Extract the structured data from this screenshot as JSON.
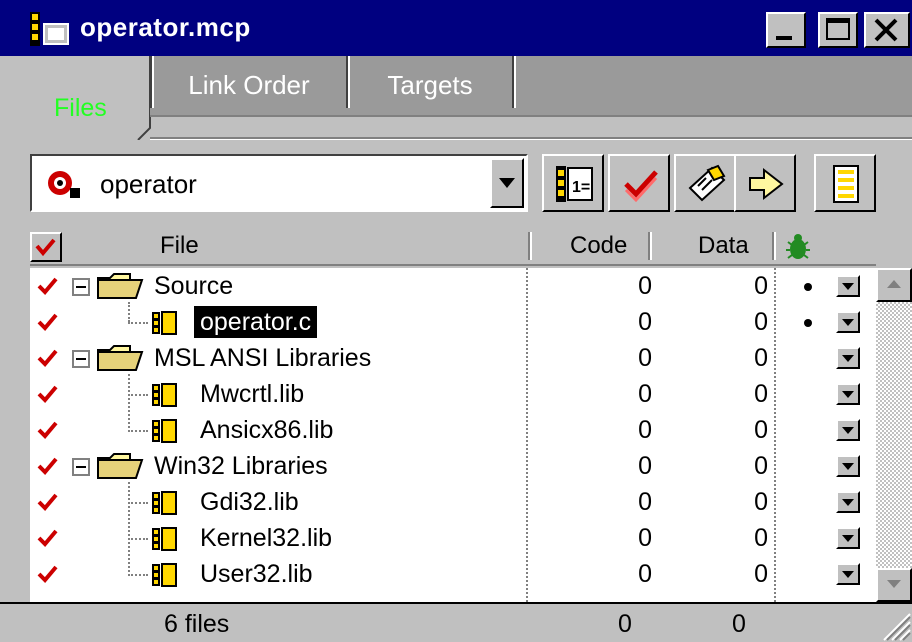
{
  "window": {
    "title": "operator.mcp"
  },
  "tabs": [
    {
      "label": "Files",
      "active": true
    },
    {
      "label": "Link Order",
      "active": false
    },
    {
      "label": "Targets",
      "active": false
    }
  ],
  "toolbar": {
    "target": "operator"
  },
  "columns": {
    "file": "File",
    "code": "Code",
    "data": "Data"
  },
  "rows": [
    {
      "label": "Source",
      "type": "group",
      "code": "0",
      "data": "0",
      "debug": true
    },
    {
      "label": "operator.c",
      "type": "file",
      "code": "0",
      "data": "0",
      "debug": true,
      "selected": true
    },
    {
      "label": "MSL ANSI Libraries",
      "type": "group",
      "code": "0",
      "data": "0",
      "debug": false
    },
    {
      "label": "Mwcrtl.lib",
      "type": "file",
      "code": "0",
      "data": "0",
      "debug": false
    },
    {
      "label": "Ansicx86.lib",
      "type": "file",
      "code": "0",
      "data": "0",
      "debug": false
    },
    {
      "label": "Win32 Libraries",
      "type": "group",
      "code": "0",
      "data": "0",
      "debug": false
    },
    {
      "label": "Gdi32.lib",
      "type": "file",
      "code": "0",
      "data": "0",
      "debug": false
    },
    {
      "label": "Kernel32.lib",
      "type": "file",
      "code": "0",
      "data": "0",
      "debug": false
    },
    {
      "label": "User32.lib",
      "type": "file",
      "code": "0",
      "data": "0",
      "debug": false
    }
  ],
  "status": {
    "files": "6 files",
    "code_total": "0",
    "data_total": "0"
  },
  "colors": {
    "titlebar": "#000080",
    "face": "#c0c0c0",
    "check": "#cc0000",
    "active_tab_text": "#22ff22"
  }
}
